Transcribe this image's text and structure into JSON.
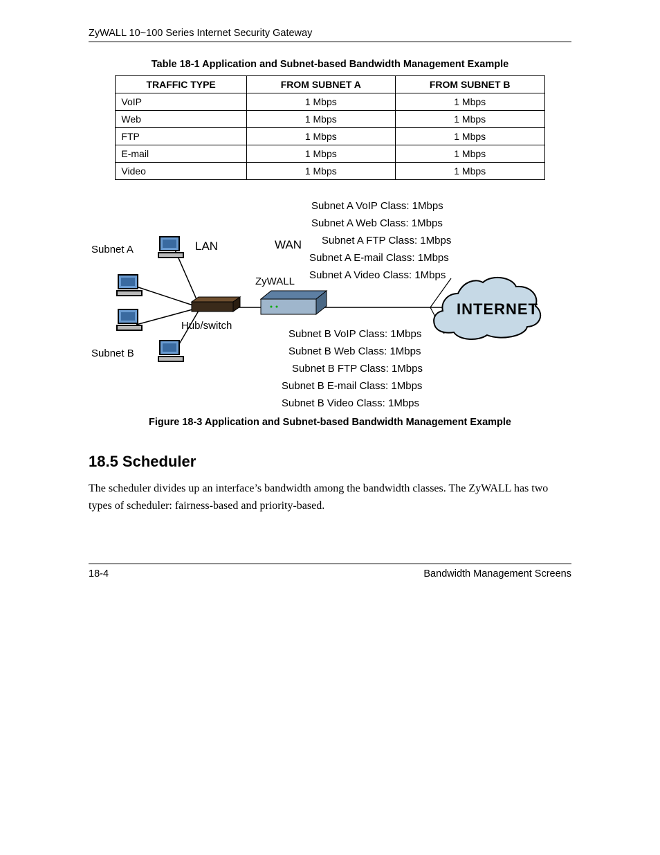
{
  "header": {
    "title": "ZyWALL 10~100 Series Internet Security Gateway"
  },
  "table": {
    "caption": "Table 18-1 Application and Subnet-based Bandwidth Management Example",
    "headers": [
      "TRAFFIC TYPE",
      "FROM SUBNET A",
      "FROM SUBNET B"
    ],
    "rows": [
      {
        "type": "VoIP",
        "a": "1 Mbps",
        "b": "1 Mbps"
      },
      {
        "type": "Web",
        "a": "1 Mbps",
        "b": "1 Mbps"
      },
      {
        "type": "FTP",
        "a": "1 Mbps",
        "b": "1 Mbps"
      },
      {
        "type": "E-mail",
        "a": "1 Mbps",
        "b": "1 Mbps"
      },
      {
        "type": "Video",
        "a": "1 Mbps",
        "b": "1 Mbps"
      }
    ]
  },
  "diagram": {
    "subnet_a": "Subnet A",
    "subnet_b": "Subnet B",
    "lan": "LAN",
    "wan": "WAN",
    "zywall": "ZyWALL",
    "hubswitch": "Hub/switch",
    "internet": "INTERNET",
    "classes_a": [
      "Subnet A VoIP Class: 1Mbps",
      "Subnet A Web Class: 1Mbps",
      "Subnet A FTP Class: 1Mbps",
      "Subnet A E-mail Class: 1Mbps",
      "Subnet A Video Class: 1Mbps"
    ],
    "classes_b": [
      "Subnet B VoIP Class: 1Mbps",
      "Subnet B Web Class: 1Mbps",
      "Subnet B FTP Class: 1Mbps",
      "Subnet B E-mail Class: 1Mbps",
      "Subnet B Video Class: 1Mbps"
    ]
  },
  "figure_caption": "Figure 18-3 Application and Subnet-based Bandwidth Management Example",
  "section": {
    "heading": "18.5  Scheduler",
    "body": "The scheduler divides up an interface’s bandwidth among the bandwidth classes. The ZyWALL has two types of scheduler: fairness-based and priority-based."
  },
  "footer": {
    "page": "18-4",
    "title": "Bandwidth Management Screens"
  }
}
